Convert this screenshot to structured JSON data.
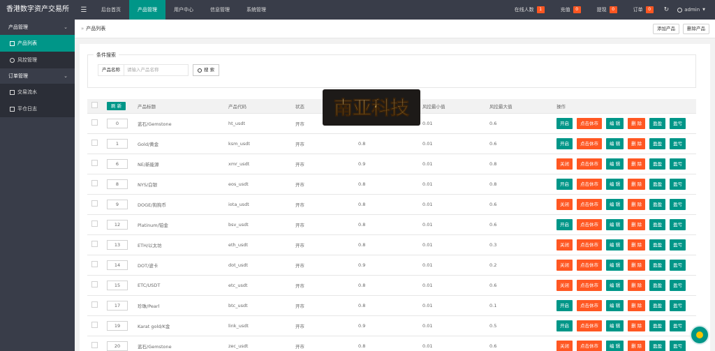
{
  "app": {
    "title": "香港数字资产交易所"
  },
  "nav": {
    "items": [
      {
        "label": "后台首页",
        "active": false
      },
      {
        "label": "产品管理",
        "active": true
      },
      {
        "label": "用户中心",
        "active": false
      },
      {
        "label": "信息管理",
        "active": false
      },
      {
        "label": "系统管理",
        "active": false
      }
    ]
  },
  "topright": {
    "online_label": "在线人数",
    "online_count": "1",
    "recharge_label": "充值",
    "recharge_count": "0",
    "withdraw_label": "提现",
    "withdraw_count": "0",
    "order_label": "订单",
    "order_count": "0",
    "user": "admin"
  },
  "sidebar": {
    "groups": [
      {
        "label": "产品管理",
        "items": [
          {
            "label": "产品列表",
            "active": true
          },
          {
            "label": "风控管理",
            "active": false
          }
        ]
      },
      {
        "label": "订单管理",
        "items": [
          {
            "label": "交易流水",
            "active": false
          },
          {
            "label": "平仓日志",
            "active": false
          }
        ]
      }
    ]
  },
  "breadcrumb": {
    "text": "产品列表",
    "add_label": "添加产品",
    "delete_label": "删除产品"
  },
  "search": {
    "legend": "条件搜索",
    "label": "产品名称",
    "placeholder": "请输入产品名称",
    "button": "搜 索"
  },
  "table": {
    "refresh_label": "刷 新",
    "headers": [
      "产品标题",
      "产品代码",
      "状态",
      "风控最小值",
      "风控最大值",
      "操作"
    ],
    "rows": [
      {
        "sort": "0",
        "title": "蓝石/Gemstone",
        "code": "ht_usdt",
        "status": "开市",
        "v1": "",
        "min": "0.01",
        "max": "0.6",
        "toggle": "开启"
      },
      {
        "sort": "1",
        "title": "Gold/黄金",
        "code": "ksm_usdt",
        "status": "开市",
        "v1": "0.8",
        "min": "0.01",
        "max": "0.6",
        "toggle": "开启"
      },
      {
        "sort": "6",
        "title": "NE/新能源",
        "code": "xmr_usdt",
        "status": "开市",
        "v1": "0.9",
        "min": "0.01",
        "max": "0.8",
        "toggle": "关闭"
      },
      {
        "sort": "8",
        "title": "NYS/白银",
        "code": "eos_usdt",
        "status": "开市",
        "v1": "0.8",
        "min": "0.01",
        "max": "0.8",
        "toggle": "开启"
      },
      {
        "sort": "9",
        "title": "DOGE/狗狗币",
        "code": "iota_usdt",
        "status": "开市",
        "v1": "0.8",
        "min": "0.01",
        "max": "0.6",
        "toggle": "关闭"
      },
      {
        "sort": "12",
        "title": "Platinum/铂金",
        "code": "bsv_usdt",
        "status": "开市",
        "v1": "0.8",
        "min": "0.01",
        "max": "0.6",
        "toggle": "开启"
      },
      {
        "sort": "13",
        "title": "ETH/以太坊",
        "code": "eth_usdt",
        "status": "开市",
        "v1": "0.8",
        "min": "0.01",
        "max": "0.3",
        "toggle": "关闭"
      },
      {
        "sort": "14",
        "title": "DOT/波卡",
        "code": "dot_usdt",
        "status": "开市",
        "v1": "0.9",
        "min": "0.01",
        "max": "0.2",
        "toggle": "关闭"
      },
      {
        "sort": "15",
        "title": "ETC/USDT",
        "code": "etc_usdt",
        "status": "开市",
        "v1": "0.8",
        "min": "0.01",
        "max": "0.6",
        "toggle": "关闭"
      },
      {
        "sort": "17",
        "title": "珍珠/Pearl",
        "code": "btc_usdt",
        "status": "开市",
        "v1": "0.8",
        "min": "0.01",
        "max": "0.1",
        "toggle": "开启"
      },
      {
        "sort": "19",
        "title": "Karat gold/K金",
        "code": "link_usdt",
        "status": "开市",
        "v1": "0.9",
        "min": "0.01",
        "max": "0.5",
        "toggle": "开启"
      },
      {
        "sort": "20",
        "title": "蓝石/Gemstone",
        "code": "zec_usdt",
        "status": "开市",
        "v1": "0.8",
        "min": "0.01",
        "max": "0.6",
        "toggle": "关闭"
      }
    ],
    "ops": {
      "close_market": "点击休市",
      "edit": "编 辑",
      "delete": "删 除",
      "win": "盈盈",
      "lose": "盈亏"
    }
  },
  "watermark": {
    "text": "南亚科技"
  },
  "colors": {
    "topbar": "#393d49",
    "accent": "#009688",
    "danger": "#ff5722"
  }
}
